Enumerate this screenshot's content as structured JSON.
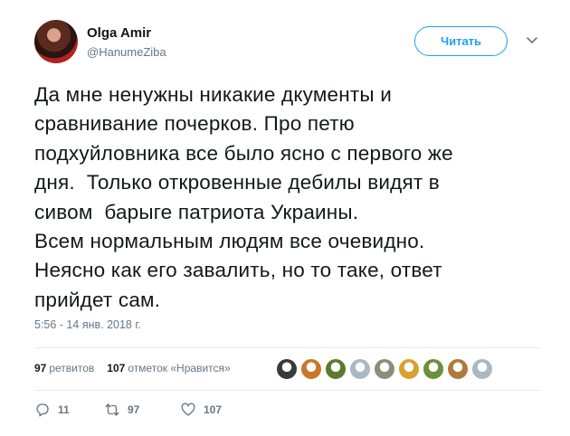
{
  "author": {
    "display_name": "Olga Amir",
    "handle": "@HanumeZiba",
    "avatar_icon": "user-avatar"
  },
  "follow_button": {
    "label": "Читать",
    "color": "#1da1f2"
  },
  "more_icon": "chevron-down-icon",
  "tweet": {
    "lines": [
      "Да мне ненужны никакие дкументы и",
      "сравнивание почерков. Про петю",
      "подхуйловника все было ясно с первого же",
      "дня.  Только откровенные дебилы видят в",
      "сивом  барыге патриота Украины.",
      "Всем нормальным людям все очевидно.",
      "Неясно как его завалить, но то таке, ответ",
      "прийдет сам."
    ],
    "timestamp": "5:56 - 14 янв. 2018 г."
  },
  "stats": {
    "retweets_count": "97",
    "retweets_label": "ретвитов",
    "likes_count": "107",
    "likes_label": "отметок «Нравится»"
  },
  "likers": [
    {
      "color": "#3a3a3a"
    },
    {
      "color": "#c9772b"
    },
    {
      "color": "#5c7a2e"
    },
    {
      "color": "#aab8c2"
    },
    {
      "color": "#8a8f7a"
    },
    {
      "color": "#d8a22e"
    },
    {
      "color": "#6b8f3a"
    },
    {
      "color": "#b07a3c"
    },
    {
      "color": "#aab8c2"
    }
  ],
  "actions": {
    "reply_count": "11",
    "retweet_count": "97",
    "like_count": "107",
    "icon_color": "#657786"
  }
}
